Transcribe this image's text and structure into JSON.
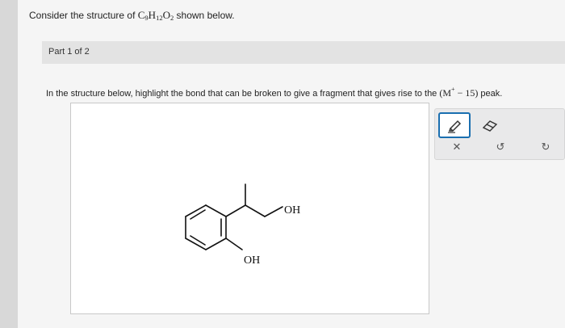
{
  "question": {
    "prefix": "Consider the structure of",
    "formula": {
      "c": "C",
      "c_n": "9",
      "h": "H",
      "h_n": "12",
      "o": "O",
      "o_n": "2"
    },
    "suffix": "shown below."
  },
  "part": {
    "label": "Part 1 of 2"
  },
  "prompt": {
    "text_before": "In the structure below, highlight the bond that can be broken to give a fragment that gives rise to the",
    "formula_open": "(M",
    "formula_sup": "+",
    "formula_rest": " − 15)",
    "text_after": "peak."
  },
  "molecule": {
    "labels": {
      "oh_right": "OH",
      "oh_bottom": "OH"
    }
  },
  "tools": {
    "pencil_icon": "pencil-icon",
    "eraser_icon": "eraser-icon",
    "clear_glyph": "✕",
    "undo_glyph": "↺",
    "redo_glyph": "↻"
  },
  "colors": {
    "accent": "#1a6fb0",
    "bond": "#111111"
  }
}
